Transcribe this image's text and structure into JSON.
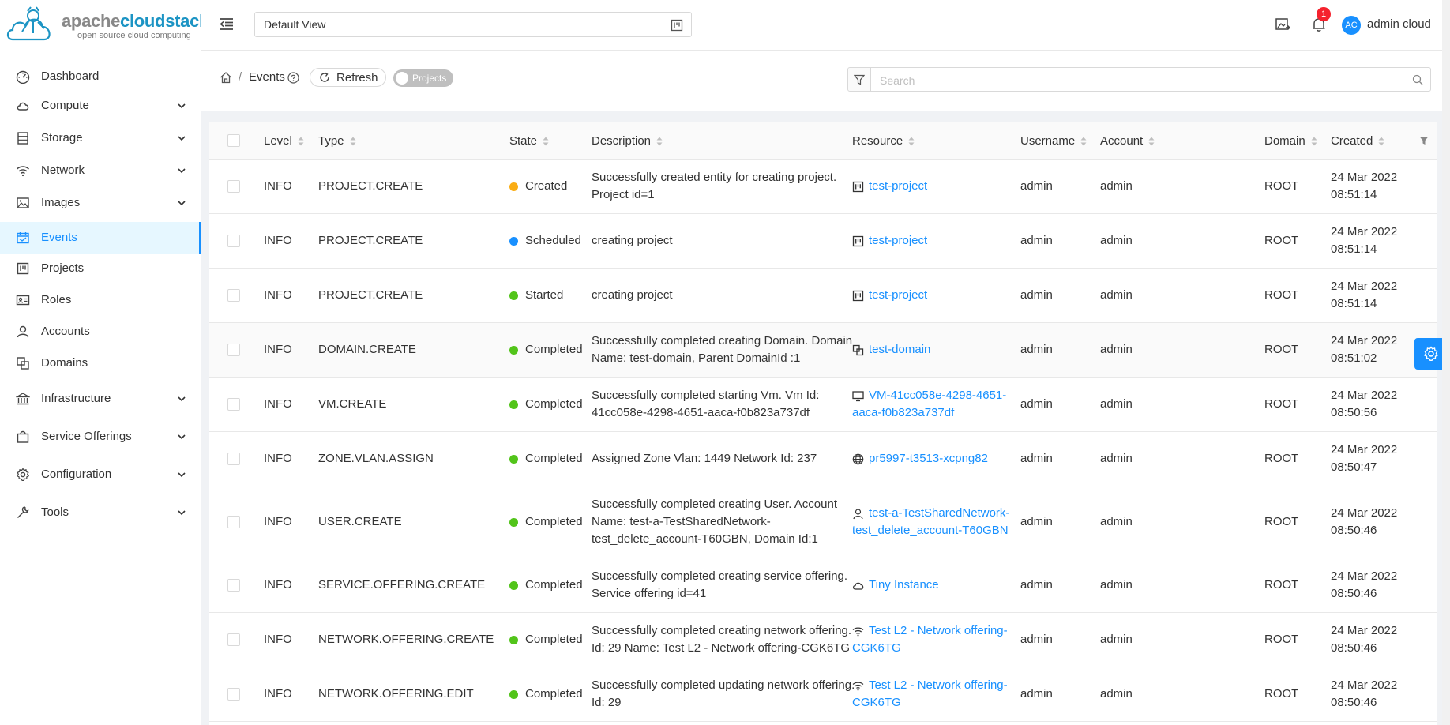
{
  "brand": {
    "name_a": "apache",
    "name_b": "cloudstack",
    "tagline": "open source cloud computing"
  },
  "sidebar": {
    "items": [
      {
        "label": "Dashboard",
        "icon": "dashboard-icon",
        "expandable": false,
        "active": false
      },
      {
        "label": "Compute",
        "icon": "cloud-icon",
        "expandable": true,
        "active": false
      },
      {
        "label": "Storage",
        "icon": "database-icon",
        "expandable": true,
        "active": false
      },
      {
        "label": "Network",
        "icon": "wifi-icon",
        "expandable": true,
        "active": false
      },
      {
        "label": "Images",
        "icon": "picture-icon",
        "expandable": true,
        "active": false
      },
      {
        "label": "Events",
        "icon": "schedule-icon",
        "expandable": false,
        "active": true
      },
      {
        "label": "Projects",
        "icon": "project-icon",
        "expandable": false,
        "active": false
      },
      {
        "label": "Roles",
        "icon": "idcard-icon",
        "expandable": false,
        "active": false
      },
      {
        "label": "Accounts",
        "icon": "team-icon",
        "expandable": false,
        "active": false
      },
      {
        "label": "Domains",
        "icon": "block-icon",
        "expandable": false,
        "active": false
      },
      {
        "label": "Infrastructure",
        "icon": "bank-icon",
        "expandable": true,
        "active": false
      },
      {
        "label": "Service Offerings",
        "icon": "shopping-icon",
        "expandable": true,
        "active": false
      },
      {
        "label": "Configuration",
        "icon": "setting-icon",
        "expandable": true,
        "active": false
      },
      {
        "label": "Tools",
        "icon": "tool-icon",
        "expandable": true,
        "active": false
      }
    ]
  },
  "header": {
    "view_label": "Default View",
    "notification_count": "1",
    "avatar_initials": "AC",
    "user_name": "admin cloud"
  },
  "toolbar": {
    "breadcrumb_sep": "/",
    "page_title": "Events",
    "refresh_label": "Refresh",
    "toggle_label": "Projects",
    "search_placeholder": "Search"
  },
  "table": {
    "columns": [
      "Level",
      "Type",
      "State",
      "Description",
      "Resource",
      "Username",
      "Account",
      "Domain",
      "Created"
    ],
    "rows": [
      {
        "level": "INFO",
        "type": "PROJECT.CREATE",
        "state": "Created",
        "state_color": "#faad14",
        "description": [
          "Successfully created entity for creating project.",
          "Project id=1"
        ],
        "resource_icon": "project-icon",
        "resource": [
          "test-project"
        ],
        "username": "admin",
        "account": "admin",
        "domain": "ROOT",
        "created": [
          "24 Mar 2022",
          "08:51:14"
        ]
      },
      {
        "level": "INFO",
        "type": "PROJECT.CREATE",
        "state": "Scheduled",
        "state_color": "#1890ff",
        "description": [
          "creating project"
        ],
        "resource_icon": "project-icon",
        "resource": [
          "test-project"
        ],
        "username": "admin",
        "account": "admin",
        "domain": "ROOT",
        "created": [
          "24 Mar 2022",
          "08:51:14"
        ]
      },
      {
        "level": "INFO",
        "type": "PROJECT.CREATE",
        "state": "Started",
        "state_color": "#52c41a",
        "description": [
          "creating project"
        ],
        "resource_icon": "project-icon",
        "resource": [
          "test-project"
        ],
        "username": "admin",
        "account": "admin",
        "domain": "ROOT",
        "created": [
          "24 Mar 2022",
          "08:51:14"
        ]
      },
      {
        "level": "INFO",
        "type": "DOMAIN.CREATE",
        "state": "Completed",
        "state_color": "#52c41a",
        "description": [
          "Successfully completed creating Domain. Domain",
          "Name: test-domain, Parent DomainId :1"
        ],
        "resource_icon": "block-icon",
        "resource": [
          "test-domain"
        ],
        "username": "admin",
        "account": "admin",
        "domain": "ROOT",
        "created": [
          "24 Mar 2022",
          "08:51:02"
        ]
      },
      {
        "level": "INFO",
        "type": "VM.CREATE",
        "state": "Completed",
        "state_color": "#52c41a",
        "description": [
          "Successfully completed starting Vm. Vm Id:",
          "41cc058e-4298-4651-aaca-f0b823a737df"
        ],
        "resource_icon": "desktop-icon",
        "resource": [
          "VM-41cc058e-4298-4651-",
          "aaca-f0b823a737df"
        ],
        "username": "admin",
        "account": "admin",
        "domain": "ROOT",
        "created": [
          "24 Mar 2022",
          "08:50:56"
        ]
      },
      {
        "level": "INFO",
        "type": "ZONE.VLAN.ASSIGN",
        "state": "Completed",
        "state_color": "#52c41a",
        "description": [
          "Assigned Zone Vlan: 1449 Network Id: 237"
        ],
        "resource_icon": "global-icon",
        "resource": [
          "pr5997-t3513-xcpng82"
        ],
        "username": "admin",
        "account": "admin",
        "domain": "ROOT",
        "created": [
          "24 Mar 2022",
          "08:50:47"
        ]
      },
      {
        "level": "INFO",
        "type": "USER.CREATE",
        "state": "Completed",
        "state_color": "#52c41a",
        "description": [
          "Successfully completed creating User. Account",
          "Name: test-a-TestSharedNetwork-",
          "test_delete_account-T60GBN, Domain Id:1"
        ],
        "resource_icon": "user-icon",
        "resource": [
          "test-a-TestSharedNetwork-",
          "test_delete_account-T60GBN"
        ],
        "username": "admin",
        "account": "admin",
        "domain": "ROOT",
        "created": [
          "24 Mar 2022",
          "08:50:46"
        ]
      },
      {
        "level": "INFO",
        "type": "SERVICE.OFFERING.CREATE",
        "state": "Completed",
        "state_color": "#52c41a",
        "description": [
          "Successfully completed creating service offering.",
          "Service offering id=41"
        ],
        "resource_icon": "cloud-icon",
        "resource": [
          "Tiny Instance"
        ],
        "username": "admin",
        "account": "admin",
        "domain": "ROOT",
        "created": [
          "24 Mar 2022",
          "08:50:46"
        ]
      },
      {
        "level": "INFO",
        "type": "NETWORK.OFFERING.CREATE",
        "state": "Completed",
        "state_color": "#52c41a",
        "description": [
          "Successfully completed creating network offering.",
          "Id: 29 Name: Test L2 - Network offering-CGK6TG"
        ],
        "resource_icon": "wifi-icon",
        "resource": [
          "Test L2 - Network offering-",
          "CGK6TG"
        ],
        "username": "admin",
        "account": "admin",
        "domain": "ROOT",
        "created": [
          "24 Mar 2022",
          "08:50:46"
        ]
      },
      {
        "level": "INFO",
        "type": "NETWORK.OFFERING.EDIT",
        "state": "Completed",
        "state_color": "#52c41a",
        "description": [
          "Successfully completed updating network offering.",
          "Id: 29"
        ],
        "resource_icon": "wifi-icon",
        "resource": [
          "Test L2 - Network offering-",
          "CGK6TG"
        ],
        "username": "admin",
        "account": "admin",
        "domain": "ROOT",
        "created": [
          "24 Mar 2022",
          "08:50:46"
        ]
      }
    ]
  }
}
